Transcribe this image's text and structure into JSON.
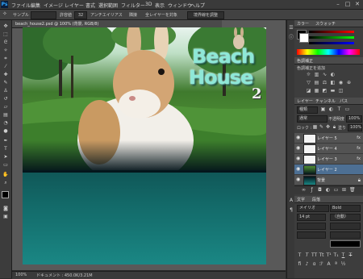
{
  "app": {
    "logo": "Ps"
  },
  "menubar": {
    "items": [
      "ファイル",
      "編集",
      "イメージ",
      "レイヤー",
      "書式",
      "選択範囲",
      "フィルター",
      "3D",
      "表示",
      "ウィンドウ",
      "ヘルプ"
    ],
    "window_controls": {
      "minimize": "–",
      "maximize": "□",
      "close": "✕"
    }
  },
  "options_bar": {
    "label_sample": "サンプル",
    "label_tolerance": "許容値",
    "tolerance_value": "32",
    "label_antialias": "アンチエイリアス",
    "label_contiguous": "隣接",
    "label_all_layers": "全レイヤーを対象",
    "refine_edge": "境界線を調整"
  },
  "document": {
    "tab_title": "beach_house2.psd @ 100% (背景, RGB/8)",
    "artwork_title_line1": "Beach",
    "artwork_title_line2": "House",
    "artwork_title_number": "2"
  },
  "statusbar": {
    "zoom": "100%",
    "doc_info": "ドキュメント : 450.0K/3.21M"
  },
  "panels": {
    "color_tab": "カラー",
    "swatches_tab": "スウォッチ",
    "adjust_tab": "色調補正",
    "adjust_subtitle": "色調補正を追加",
    "layers_tab": "レイヤー",
    "channels_tab": "チャンネル",
    "paths_tab": "パス",
    "kind_filter": "種類",
    "blend_mode": "通常",
    "opacity_label": "不透明度 :",
    "opacity_value": "100%",
    "lock_label": "ロック :",
    "fill_label": "塗り :",
    "fill_value": "100%",
    "char_tab": "文字",
    "para_tab": "段落",
    "font_family": "メイリオ",
    "font_style": "Bold",
    "font_size": "14 pt",
    "leading": "（自動）"
  },
  "layers": [
    {
      "name": "レイヤー 5",
      "selected": false,
      "thumb": "white",
      "fx": "fx"
    },
    {
      "name": "レイヤー 4",
      "selected": false,
      "thumb": "white",
      "fx": "fx"
    },
    {
      "name": "レイヤー 3",
      "selected": false,
      "thumb": "white",
      "fx": "fx"
    },
    {
      "name": "レイヤー 2",
      "selected": true,
      "thumb": "photo",
      "fx": ""
    },
    {
      "name": "背景",
      "selected": false,
      "thumb": "teal",
      "fx": ""
    }
  ],
  "colors": {
    "accent_selected": "#4d6f93",
    "canvas_bottom": "#1a8784",
    "foreground_swatch": "#000000",
    "background_swatch": "#ffffff"
  }
}
